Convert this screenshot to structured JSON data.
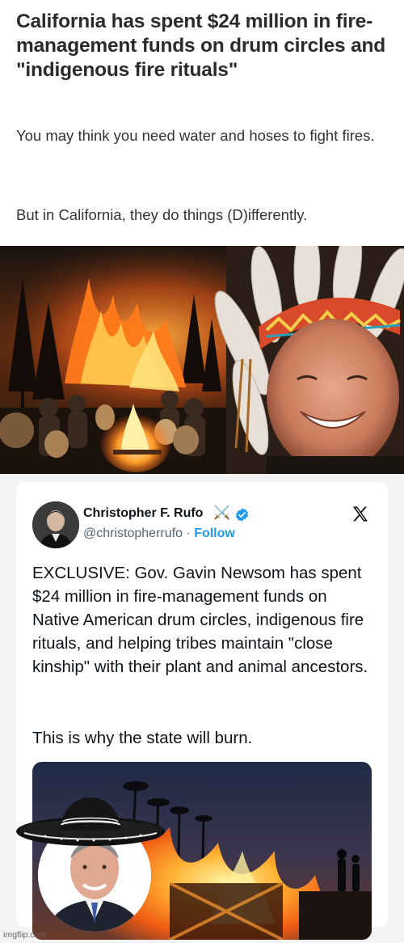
{
  "article": {
    "headline": "California has spent $24 million in fire-management funds on drum circles and \"indigenous fire rituals\"",
    "paragraph_1": "You may think you need water and hoses to fight fires.",
    "paragraph_2": "But in California, they do things (D)ifferently."
  },
  "tweet": {
    "display_name": "Christopher F. Rufo",
    "name_emoji": "⚔️",
    "handle": "@christopherrufo",
    "separator": " · ",
    "follow_label": "Follow",
    "text_1": "EXCLUSIVE: Gov. Gavin Newsom has spent $24 million in fire-management funds on Native American drum circles, indigenous fire rituals, and helping tribes maintain \"close kinship\" with their plant and animal ancestors.",
    "text_2": "This is why the state will burn.",
    "colors": {
      "link": "#1d9bf0",
      "verified": "#1d9bf0",
      "text": "#0f1419",
      "muted": "#536471"
    },
    "icons": [
      "verified-badge-icon",
      "x-logo-icon",
      "crossed-swords-icon"
    ]
  },
  "watermark": "imgflip.com"
}
